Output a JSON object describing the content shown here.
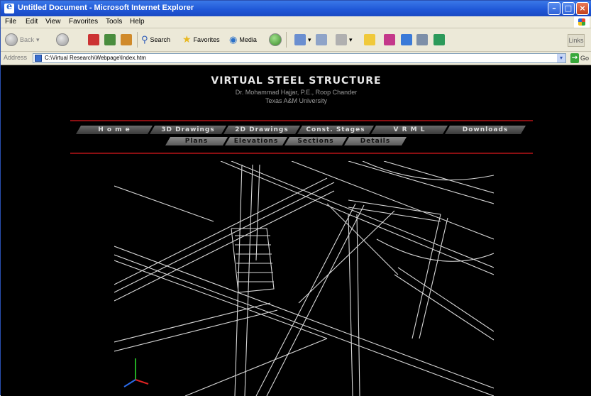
{
  "window": {
    "title": "Untitled Document - Microsoft Internet Explorer"
  },
  "menu": [
    "File",
    "Edit",
    "View",
    "Favorites",
    "Tools",
    "Help"
  ],
  "toolbar": {
    "back_label": "Back",
    "search_label": "Search",
    "favorites_label": "Favorites",
    "media_label": "Media",
    "links_label": "Links"
  },
  "address": {
    "label": "Address",
    "url": "C:\\Virtual Research\\Webpage\\Index.htm",
    "go_label": "Go"
  },
  "site": {
    "title": "VIRTUAL STEEL STRUCTURE",
    "author": "Dr. Mohammad Hajjar, P.E., Roop Chander",
    "university": "Texas A&M University"
  },
  "nav_row1": [
    "H o m e",
    "3D Drawings",
    "2D Drawings",
    "Const. Stages",
    "V R M L",
    "Downloads"
  ],
  "nav_row2": [
    "Plans",
    "Elevations",
    "Sections",
    "Details"
  ],
  "colors": {
    "title_bar": "#1f56d6",
    "chrome": "#ece9d8",
    "page_bg": "#000000",
    "accent_red": "#8b0f12"
  }
}
